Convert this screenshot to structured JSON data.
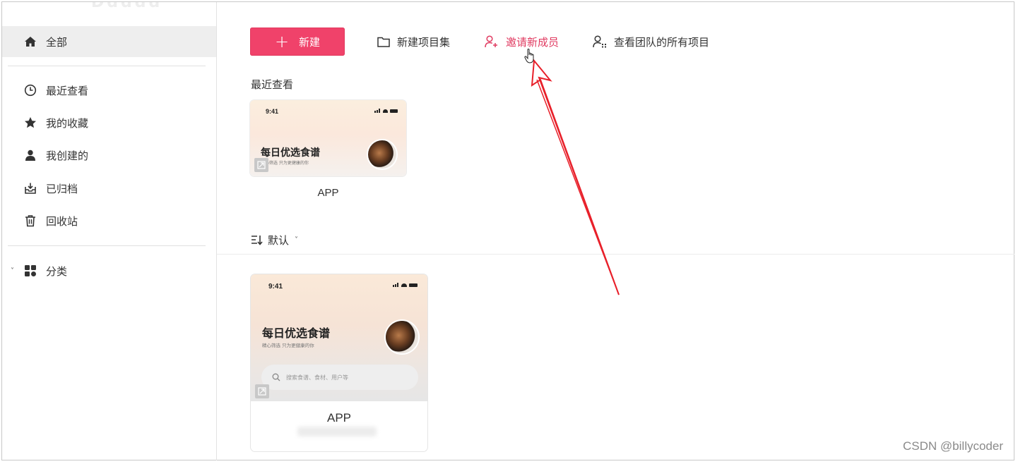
{
  "sidebar": {
    "logo_text": "Ddddd",
    "items": [
      {
        "label": "全部",
        "icon": "home-icon",
        "active": true
      },
      {
        "label": "最近查看",
        "icon": "clock-icon"
      },
      {
        "label": "我的收藏",
        "icon": "star-icon"
      },
      {
        "label": "我创建的",
        "icon": "user-icon"
      },
      {
        "label": "已归档",
        "icon": "archive-icon"
      },
      {
        "label": "回收站",
        "icon": "trash-icon"
      }
    ],
    "category": {
      "label": "分类",
      "icon": "grid-icon"
    }
  },
  "toolbar": {
    "new_label": "新建",
    "new_project_set": "新建项目集",
    "invite_member": "邀请新成员",
    "view_team_projects": "查看团队的所有项目"
  },
  "recent": {
    "title": "最近查看",
    "card": {
      "time": "9:41",
      "title": "每日优选食谱",
      "subtitle": "精心筛选 只为更健康的你",
      "label": "APP"
    }
  },
  "sort": {
    "label": "默认"
  },
  "projects": [
    {
      "time": "9:41",
      "title": "每日优选食谱",
      "subtitle": "精心筛选 只为更健康的你",
      "search_placeholder": "搜索食谱、食材、用户等",
      "label": "APP"
    }
  ],
  "colors": {
    "accent": "#f0426a",
    "invite": "#e03a60",
    "annotation": "#e8202a"
  },
  "watermark": "CSDN @billycoder"
}
